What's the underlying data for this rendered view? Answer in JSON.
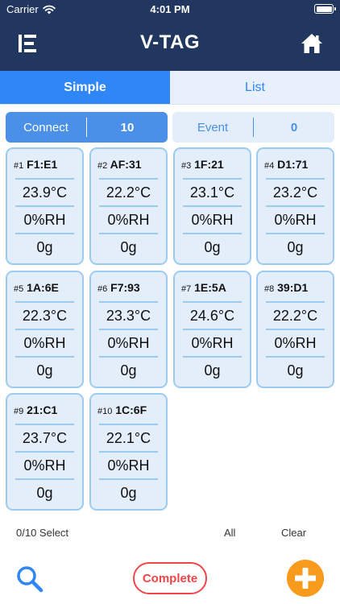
{
  "status_bar": {
    "carrier": "Carrier",
    "time": "4:01 PM"
  },
  "header": {
    "title": "V-TAG",
    "menu_icon": "menu-icon",
    "home_icon": "home-icon"
  },
  "tabs": [
    {
      "label": "Simple",
      "active": true
    },
    {
      "label": "List",
      "active": false
    }
  ],
  "counters": {
    "connect": {
      "label": "Connect",
      "value": "10"
    },
    "event": {
      "label": "Event",
      "value": "0"
    }
  },
  "tags": [
    {
      "num": "#1",
      "id": "F1:E1",
      "temp": "23.9°C",
      "humidity": "0%RH",
      "weight": "0g"
    },
    {
      "num": "#2",
      "id": "AF:31",
      "temp": "22.2°C",
      "humidity": "0%RH",
      "weight": "0g"
    },
    {
      "num": "#3",
      "id": "1F:21",
      "temp": "23.1°C",
      "humidity": "0%RH",
      "weight": "0g"
    },
    {
      "num": "#4",
      "id": "D1:71",
      "temp": "23.2°C",
      "humidity": "0%RH",
      "weight": "0g"
    },
    {
      "num": "#5",
      "id": "1A:6E",
      "temp": "22.3°C",
      "humidity": "0%RH",
      "weight": "0g"
    },
    {
      "num": "#6",
      "id": "F7:93",
      "temp": "23.3°C",
      "humidity": "0%RH",
      "weight": "0g"
    },
    {
      "num": "#7",
      "id": "1E:5A",
      "temp": "24.6°C",
      "humidity": "0%RH",
      "weight": "0g"
    },
    {
      "num": "#8",
      "id": "39:D1",
      "temp": "22.2°C",
      "humidity": "0%RH",
      "weight": "0g"
    },
    {
      "num": "#9",
      "id": "21:C1",
      "temp": "23.7°C",
      "humidity": "0%RH",
      "weight": "0g"
    },
    {
      "num": "#10",
      "id": "1C:6F",
      "temp": "22.1°C",
      "humidity": "0%RH",
      "weight": "0g"
    }
  ],
  "selection": {
    "count_label": "0/10 Select",
    "all_label": "All",
    "clear_label": "Clear"
  },
  "toolbar": {
    "complete_label": "Complete",
    "search_icon": "search-icon",
    "add_icon": "add-icon"
  },
  "colors": {
    "header_bg": "#213760",
    "accent_blue": "#2f86f6",
    "card_bg": "#e4eefa",
    "card_border": "#9ccbf0",
    "complete_red": "#f0464a",
    "add_orange": "#f89a1c"
  }
}
